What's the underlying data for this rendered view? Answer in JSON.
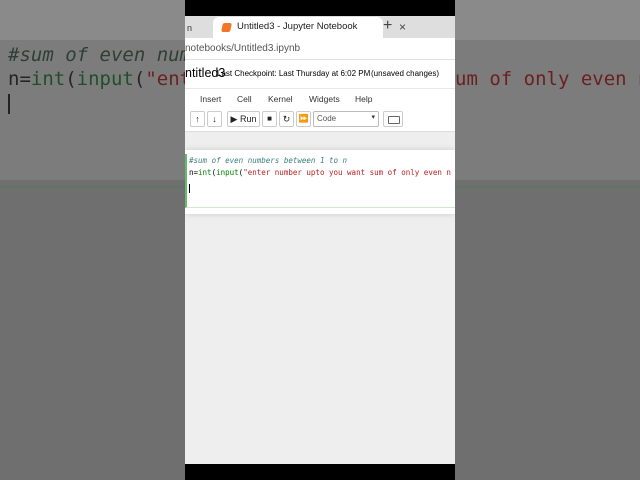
{
  "browser": {
    "prev_tab_label": "n",
    "active_tab_title": "Untitled3 - Jupyter Notebook",
    "close_symbol": "×",
    "new_tab_symbol": "+",
    "url": "notebooks/Untitled3.ipynb"
  },
  "notebook": {
    "title": "ntitled3",
    "checkpoint": "Last Checkpoint: Last Thursday at 6:02 PM",
    "unsaved": "(unsaved changes)"
  },
  "menu": {
    "items": [
      "Insert",
      "Cell",
      "Kernel",
      "Widgets",
      "Help"
    ]
  },
  "toolbar": {
    "up_symbol": "↑",
    "down_symbol": "↓",
    "run_label": "▶ Run",
    "stop_symbol": "■",
    "restart_symbol": "↻",
    "fastforward_symbol": "⏩",
    "cell_type": "Code",
    "dropdown_arrow": "▾"
  },
  "cell": {
    "line1": "#sum of even numbers between 1 to n",
    "line2_a": "n=",
    "line2_b": "int",
    "line2_c": "(",
    "line2_d": "input",
    "line2_e": "(",
    "line2_f": "\"enter number upto you want sum of only even n"
  },
  "background": {
    "code1": "#sum of even numb",
    "code2_a": "n=",
    "code2_b": "int",
    "code2_c": "(",
    "code2_d": "input",
    "code2_e": "(",
    "code2_f": "\"ent",
    "right_text": "um of only even n"
  },
  "colors": {
    "jupyter_orange": "#f37626",
    "cell_green": "#66bb6a",
    "comment": "#408080",
    "keyword": "#008000",
    "string": "#ba2121"
  }
}
